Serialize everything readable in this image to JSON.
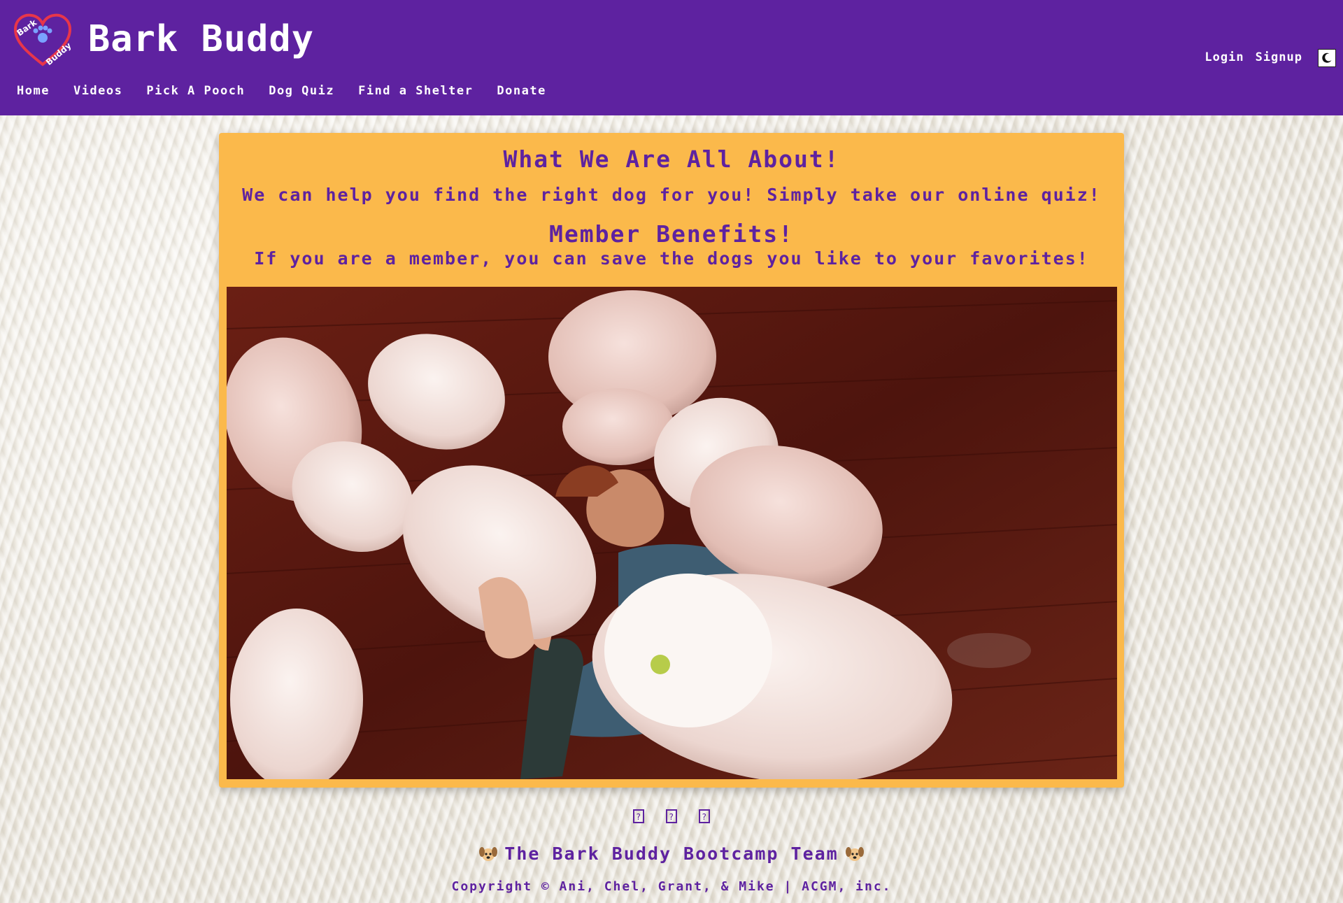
{
  "header": {
    "brand_title": "Bark Buddy",
    "logo_text_top": "Bark",
    "logo_text_bottom": "Buddy",
    "nav": [
      {
        "label": "Home"
      },
      {
        "label": "Videos"
      },
      {
        "label": "Pick A Pooch"
      },
      {
        "label": "Dog Quiz"
      },
      {
        "label": "Find a Shelter"
      },
      {
        "label": "Donate"
      }
    ],
    "auth": {
      "login_label": "Login",
      "signup_label": "Signup"
    },
    "theme_toggle_icon": "moon-icon"
  },
  "main": {
    "about_heading": "What We Are All About!",
    "about_text": "We can help you find the right dog for you! Simply take our online quiz!",
    "benefits_heading": "Member Benefits!",
    "benefits_text": "If you are a member, you can save the dogs you like to your favorites!"
  },
  "footer": {
    "social_icons": [
      "github-icon",
      "linkedin-icon",
      "email-icon"
    ],
    "team_text": "The Bark Buddy Bootcamp Team",
    "copyright": "Copyright © Ani, Chel, Grant, & Mike | ACGM, inc."
  },
  "colors": {
    "brand_purple": "#5e22a0",
    "card_orange": "#fbb94b",
    "heart_red": "#e8364a"
  }
}
